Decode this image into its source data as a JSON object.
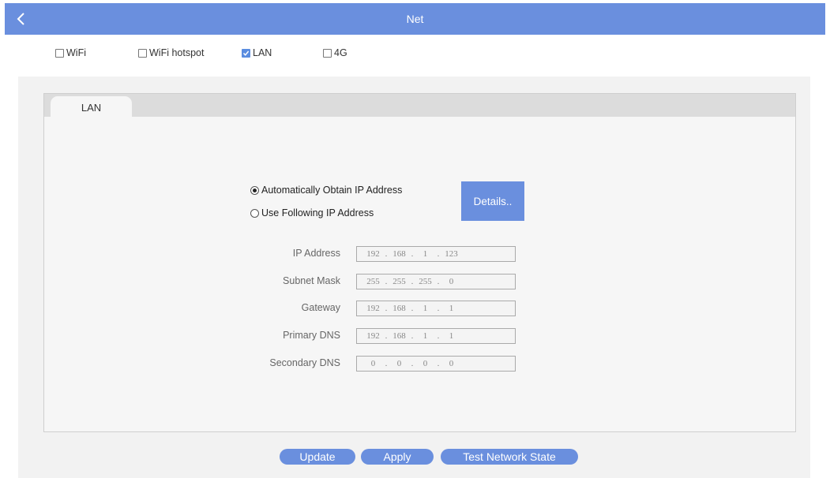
{
  "header": {
    "title": "Net",
    "back_icon": "chevron-left-icon",
    "color": "#6a8fde"
  },
  "net_types": [
    {
      "label": "WiFi",
      "checked": false
    },
    {
      "label": "WiFi hotspot",
      "checked": false
    },
    {
      "label": "LAN",
      "checked": true
    },
    {
      "label": "4G",
      "checked": false
    }
  ],
  "tab": {
    "label": "LAN"
  },
  "ip_mode": {
    "auto_label": "Automatically Obtain IP Address",
    "manual_label": "Use Following IP Address",
    "selected": "auto"
  },
  "details_button": {
    "label": "Details.."
  },
  "fields": [
    {
      "label": "IP Address",
      "octets": [
        "192",
        "168",
        "1",
        "123"
      ]
    },
    {
      "label": "Subnet Mask",
      "octets": [
        "255",
        "255",
        "255",
        "0"
      ]
    },
    {
      "label": "Gateway",
      "octets": [
        "192",
        "168",
        "1",
        "1"
      ]
    },
    {
      "label": "Primary DNS",
      "octets": [
        "192",
        "168",
        "1",
        "1"
      ]
    },
    {
      "label": "Secondary DNS",
      "octets": [
        "0",
        "0",
        "0",
        "0"
      ]
    }
  ],
  "ip_separator": ".",
  "actions": {
    "update_label": "Update",
    "apply_label": "Apply",
    "test_label": "Test Network State"
  },
  "colors": {
    "accent": "#6a8fde",
    "checkbox_checked": "#5b8de0"
  }
}
